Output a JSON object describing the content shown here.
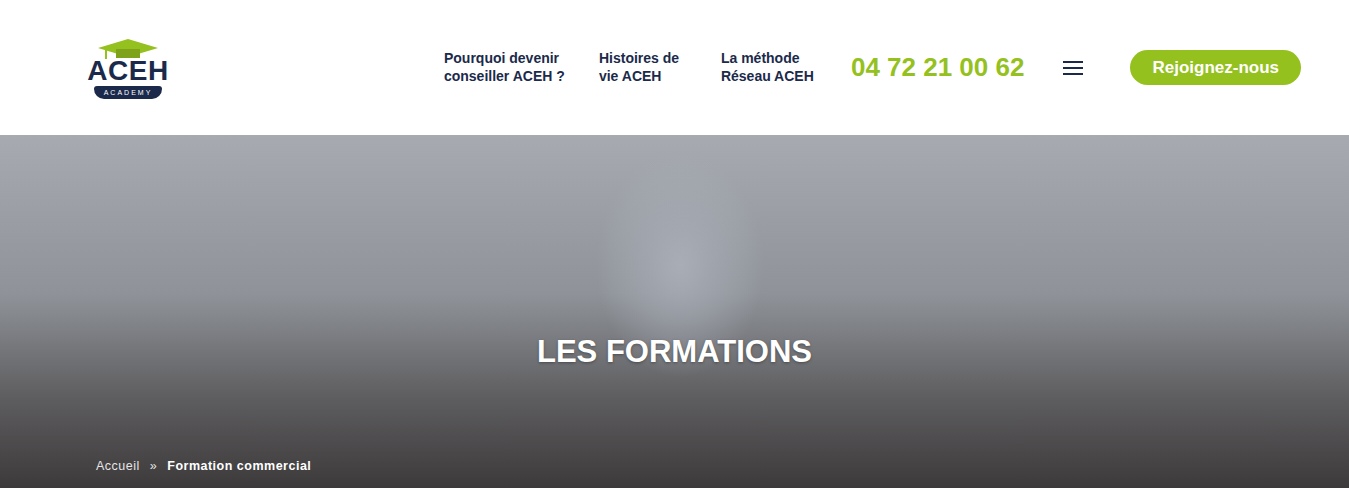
{
  "logo": {
    "name": "ACEH",
    "tagline": "ACADEMY"
  },
  "nav": {
    "links": [
      {
        "label": "Pourquoi devenir conseiller ACEH ?"
      },
      {
        "label": "Histoires de vie ACEH"
      },
      {
        "label": "La méthode Réseau ACEH"
      }
    ],
    "phone": "04 72 21 00 62",
    "button": "Rejoignez-nous"
  },
  "hero": {
    "title": "LES FORMATIONS",
    "separator": "»",
    "breadcrumb": [
      {
        "label": "Accueil",
        "current": false
      },
      {
        "label": "Formation commercial",
        "current": true
      }
    ]
  }
}
